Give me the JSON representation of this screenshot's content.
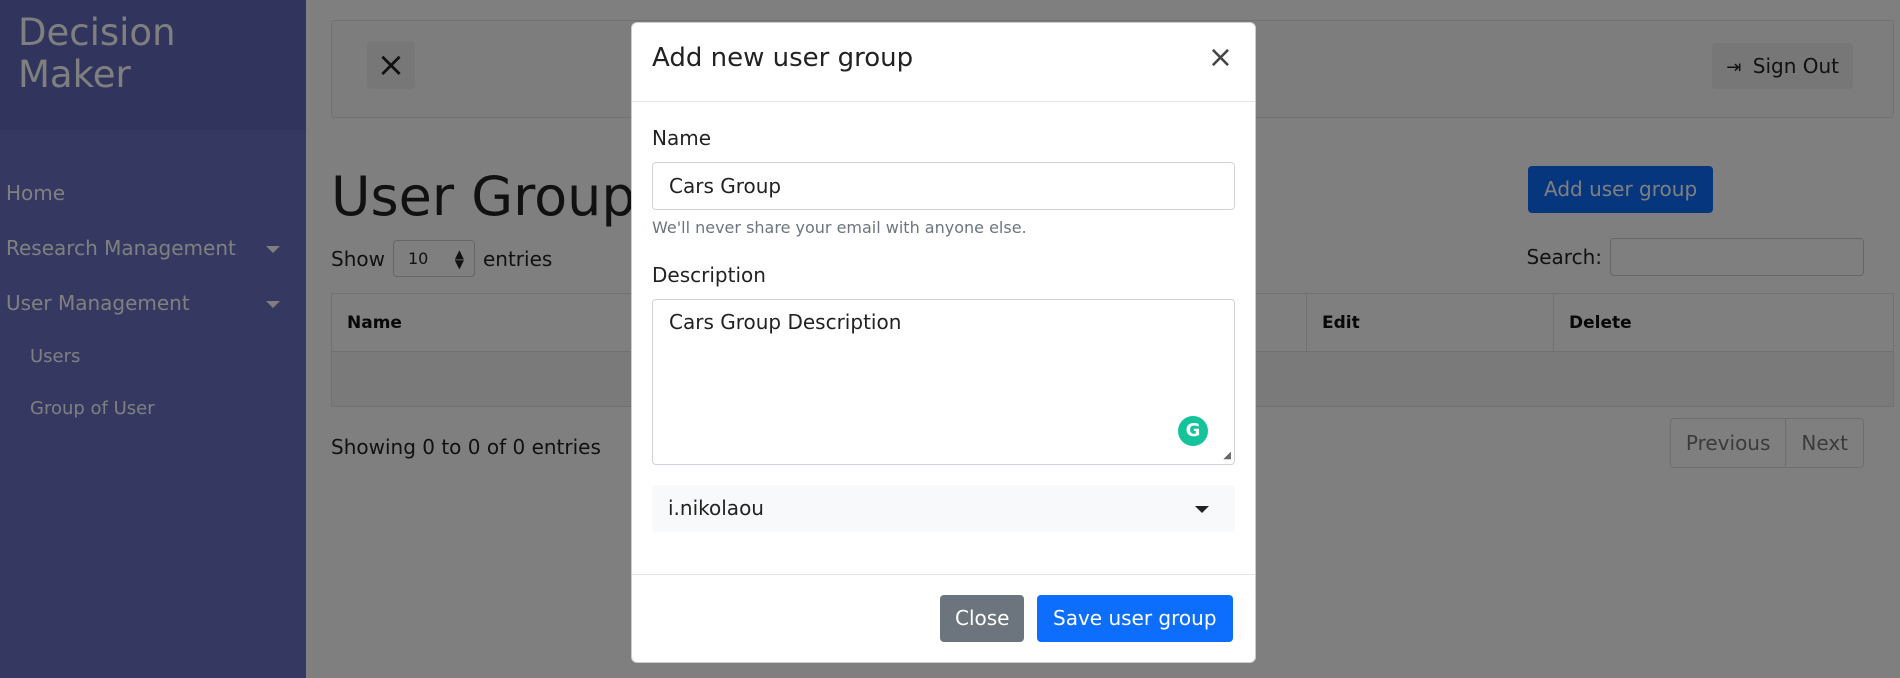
{
  "sidebar": {
    "brand_line1": "Decision",
    "brand_line2": "Maker",
    "items": [
      {
        "label": "Home"
      },
      {
        "label": "Research Management"
      },
      {
        "label": "User Management"
      }
    ],
    "subitems": [
      {
        "label": "Users"
      },
      {
        "label": "Group of User"
      }
    ]
  },
  "topbar": {
    "close_icon": "×",
    "signout_label": "Sign Out"
  },
  "page": {
    "title": "User Groups",
    "add_button": "Add user group",
    "show_label": "Show",
    "entries_value": "10",
    "entries_label": "entries",
    "search_label": "Search:",
    "table_headers": [
      "Name",
      "Edit",
      "Delete"
    ],
    "showing_text": "Showing 0 to 0 of 0 entries",
    "prev_label": "Previous",
    "next_label": "Next"
  },
  "modal": {
    "title": "Add new user group",
    "close_icon": "×",
    "name_label": "Name",
    "name_value": "Cars Group",
    "help_text": "We'll never share your email with anyone else.",
    "description_label": "Description",
    "description_value": "Cars Group Description",
    "select_value": "i.nikolaou",
    "close_button": "Close",
    "save_button": "Save user group"
  }
}
